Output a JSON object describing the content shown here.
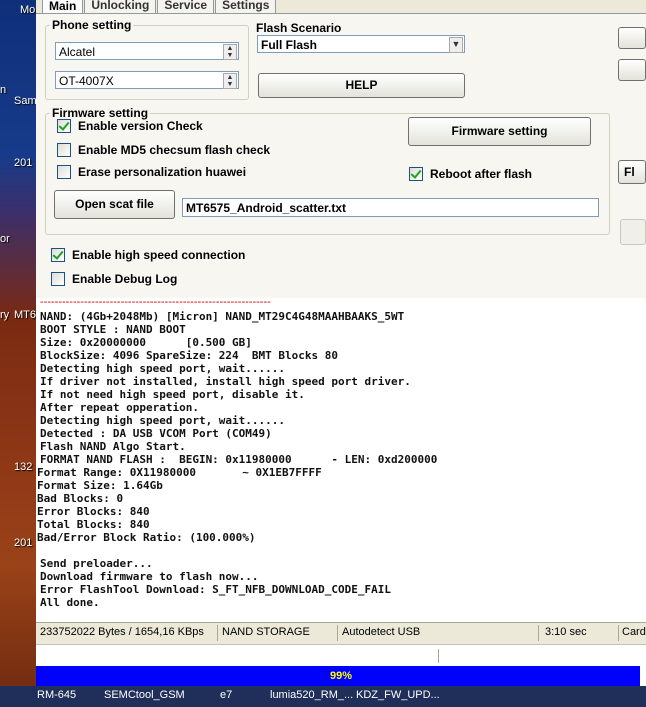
{
  "tabs": [
    "Main",
    "Unlocking",
    "Service",
    "Settings"
  ],
  "desktop_labels": [
    "Mo",
    "n",
    "Sam",
    "201",
    "or",
    "ry",
    "MT6",
    "132",
    "201"
  ],
  "phone_setting": {
    "legend": "Phone setting",
    "brand": "Alcatel",
    "model": "OT-4007X"
  },
  "flash_scenario": {
    "label": "Flash Scenario",
    "value": "Full Flash"
  },
  "help_label": "HELP",
  "firmware_setting": {
    "legend": "Firmware setting",
    "enable_version_check": "Enable version Check",
    "enable_md5": "Enable MD5 checsum flash check",
    "erase_personalization": "Erase personalization huawei",
    "reboot_after_flash": "Reboot after flash",
    "button": "Firmware setting",
    "open_scat_file": "Open scat file",
    "scatter_file": "MT6575_Android_scatter.txt"
  },
  "enable_high_speed": "Enable high speed connection",
  "enable_debug_log": "Enable Debug Log",
  "right_button_partial": "Fl",
  "log": {
    "separator": "---------------------------------------------------------------",
    "lines": [
      "NAND: (4Gb+2048Mb) [Micron] NAND_MT29C4G48MAAHBAAKS_5WT",
      "BOOT STYLE : NAND BOOT",
      "Size: 0x20000000      [0.500 GB]",
      "BlockSize: 4096 SpareSize: 224  BMT Blocks 80",
      "Detecting high speed port, wait......",
      "If driver not installed, install high speed port driver.",
      "If not need high speed port, disable it.",
      "After repeat opperation.",
      "Detecting high speed port, wait......",
      "Detected : DA USB VCOM Port (COM49)",
      "Flash NAND Algo Start.",
      "FORMAT NAND FLASH :  BEGIN: 0x11980000      - LEN: 0xd200000",
      "Format Range: 0X11980000       ~ 0X1EB7FFFF",
      "Format Size: 1.64Gb",
      "Bad Blocks: 0",
      "Error Blocks: 840",
      "Total Blocks: 840",
      "Bad/Error Block Ratio: (100.000%)",
      "",
      "Send preloader...",
      "Download firmware to flash now...",
      "Error FlashTool Download: S_FT_NFB_DOWNLOAD_CODE_FAIL",
      "All done."
    ]
  },
  "status": {
    "transfer": "233752022 Bytes / 1654,16 KBps",
    "storage": "NAND STORAGE",
    "port": "Autodetect USB",
    "time": "3:10 sec",
    "card": "Card"
  },
  "progress": {
    "value": 99,
    "label": "99%"
  },
  "taskbar": [
    "RM-645",
    "SEMCtool_GSM",
    "e7",
    "lumia520_RM_...",
    "KDZ_FW_UPD..."
  ],
  "colors": {
    "progress_fill": "#0000ff",
    "progress_text": "#ffff00",
    "separator": "#d00000",
    "check_mark": "#21a121"
  }
}
